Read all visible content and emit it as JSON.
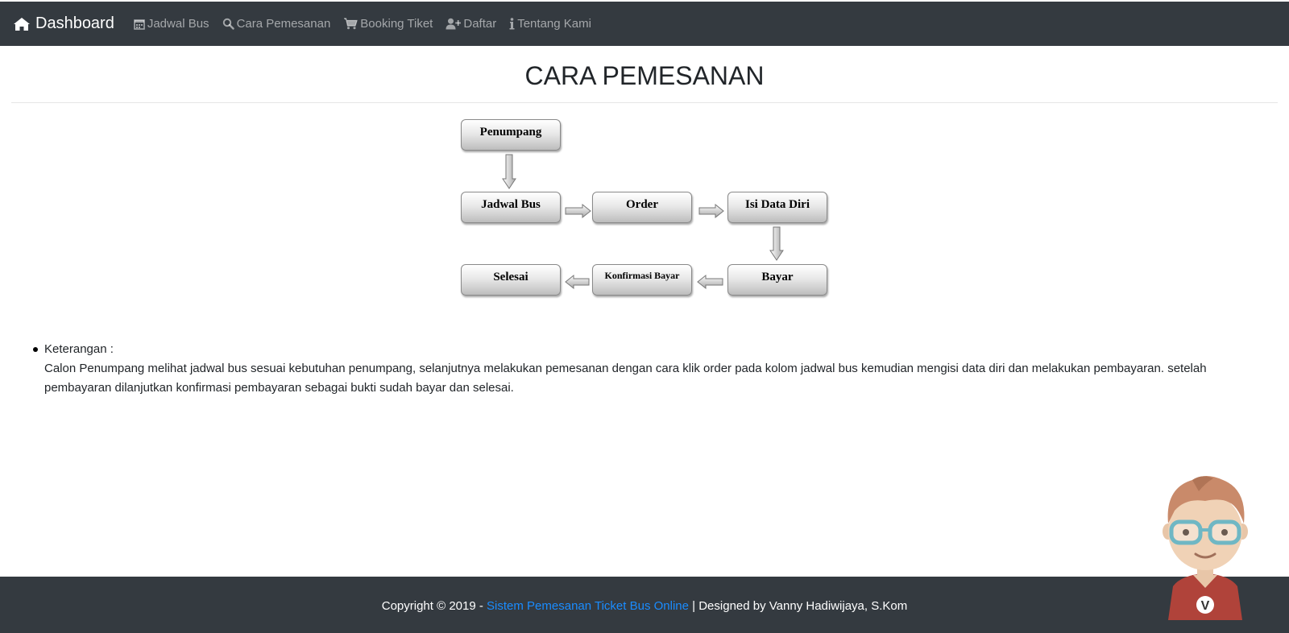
{
  "navbar": {
    "brand": "Dashboard",
    "items": [
      {
        "label": "Jadwal Bus",
        "icon": "calendar-icon"
      },
      {
        "label": "Cara Pemesanan",
        "icon": "search-icon"
      },
      {
        "label": "Booking Tiket",
        "icon": "cart-icon"
      },
      {
        "label": "Daftar",
        "icon": "user-plus-icon"
      },
      {
        "label": "Tentang Kami",
        "icon": "info-icon"
      }
    ]
  },
  "page": {
    "title": "CARA PEMESANAN"
  },
  "flowchart": {
    "steps": {
      "penumpang": "Penumpang",
      "jadwal_bus": "Jadwal Bus",
      "order": "Order",
      "isi_data_diri": "Isi Data Diri",
      "bayar": "Bayar",
      "konfirmasi_bayar": "Konfirmasi Bayar",
      "selesai": "Selesai"
    }
  },
  "info": {
    "heading": "Keterangan :",
    "text": "Calon Penumpang melihat jadwal bus sesuai kebutuhan penumpang, selanjutnya melakukan pemesanan dengan cara klik order pada kolom jadwal bus kemudian mengisi data diri dan melakukan pembayaran. setelah pembayaran dilanjutkan konfirmasi pembayaran sebagai bukti sudah bayar dan selesai."
  },
  "footer": {
    "prefix": "Copyright © 2019 - ",
    "link": "Sistem Pemesanan Ticket Bus Online",
    "suffix": " | Designed by Vanny Hadiwijaya, S.Kom"
  },
  "mascot": {
    "badge": "V"
  },
  "colors": {
    "navbar_bg": "#343a40",
    "link": "#1a8cff"
  }
}
